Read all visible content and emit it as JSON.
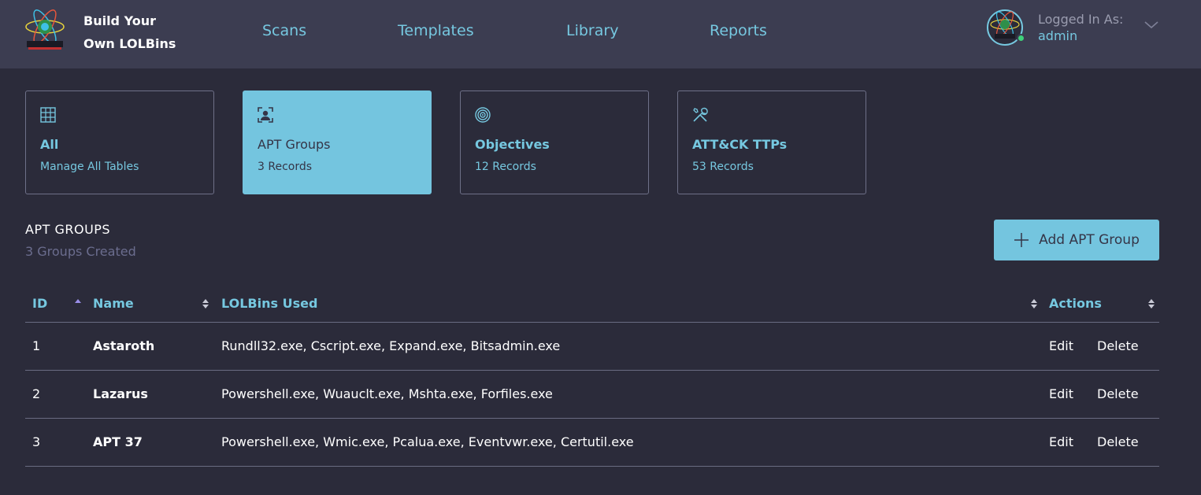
{
  "header": {
    "brand_line1": "Build Your",
    "brand_line2": "Own LOLBins",
    "nav": [
      "Scans",
      "Templates",
      "Library",
      "Reports"
    ],
    "logged_in_label": "Logged In As:",
    "username": "admin"
  },
  "cards": [
    {
      "title": "All",
      "subtitle": "Manage All Tables",
      "icon": "grid-icon",
      "active": false
    },
    {
      "title": "APT Groups",
      "subtitle": "3 Records",
      "icon": "user-scan-icon",
      "active": true
    },
    {
      "title": "Objectives",
      "subtitle": "12 Records",
      "icon": "target-icon",
      "active": false
    },
    {
      "title": "ATT&CK TTPs",
      "subtitle": "53 Records",
      "icon": "tools-icon",
      "active": false
    }
  ],
  "section": {
    "title": "APT GROUPS",
    "subtitle": "3 Groups Created",
    "add_button": "Add APT Group"
  },
  "table": {
    "columns": [
      "ID",
      "Name",
      "LOLBins Used",
      "Actions"
    ],
    "rows": [
      {
        "id": "1",
        "name": "Astaroth",
        "lolbins": "Rundll32.exe, Cscript.exe, Expand.exe, Bitsadmin.exe"
      },
      {
        "id": "2",
        "name": "Lazarus",
        "lolbins": "Powershell.exe, Wuauclt.exe, Mshta.exe, Forfiles.exe"
      },
      {
        "id": "3",
        "name": "APT 37",
        "lolbins": "Powershell.exe, Wmic.exe, Pcalua.exe, Eventvwr.exe, Certutil.exe"
      }
    ],
    "edit_label": "Edit",
    "delete_label": "Delete"
  },
  "colors": {
    "accent": "#74c5df",
    "background": "#2b2b3a",
    "header": "#3c3d51",
    "online": "#3ed17a"
  }
}
